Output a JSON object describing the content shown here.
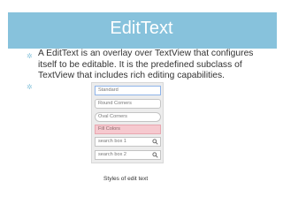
{
  "slide": {
    "title": "EditText",
    "bullet_glyph": "✲",
    "body": "A EditText is an overlay over TextView that configures itself to be editable. It is the predefined subclass of TextView that includes rich editing capabilities.",
    "caption": "Styles of edit text"
  },
  "screenshot": {
    "fields": {
      "standard": "Standard",
      "round": "Round Corners",
      "oval": "Oval Corners",
      "fill": "Fill Colors",
      "search1": "search box 1",
      "search2": "search box 2"
    },
    "search_icon": "magnifier-icon"
  },
  "colors": {
    "title_bar": "#87c2dc",
    "bullet": "#8fc7de",
    "fill_field": "#f6c9cf"
  }
}
